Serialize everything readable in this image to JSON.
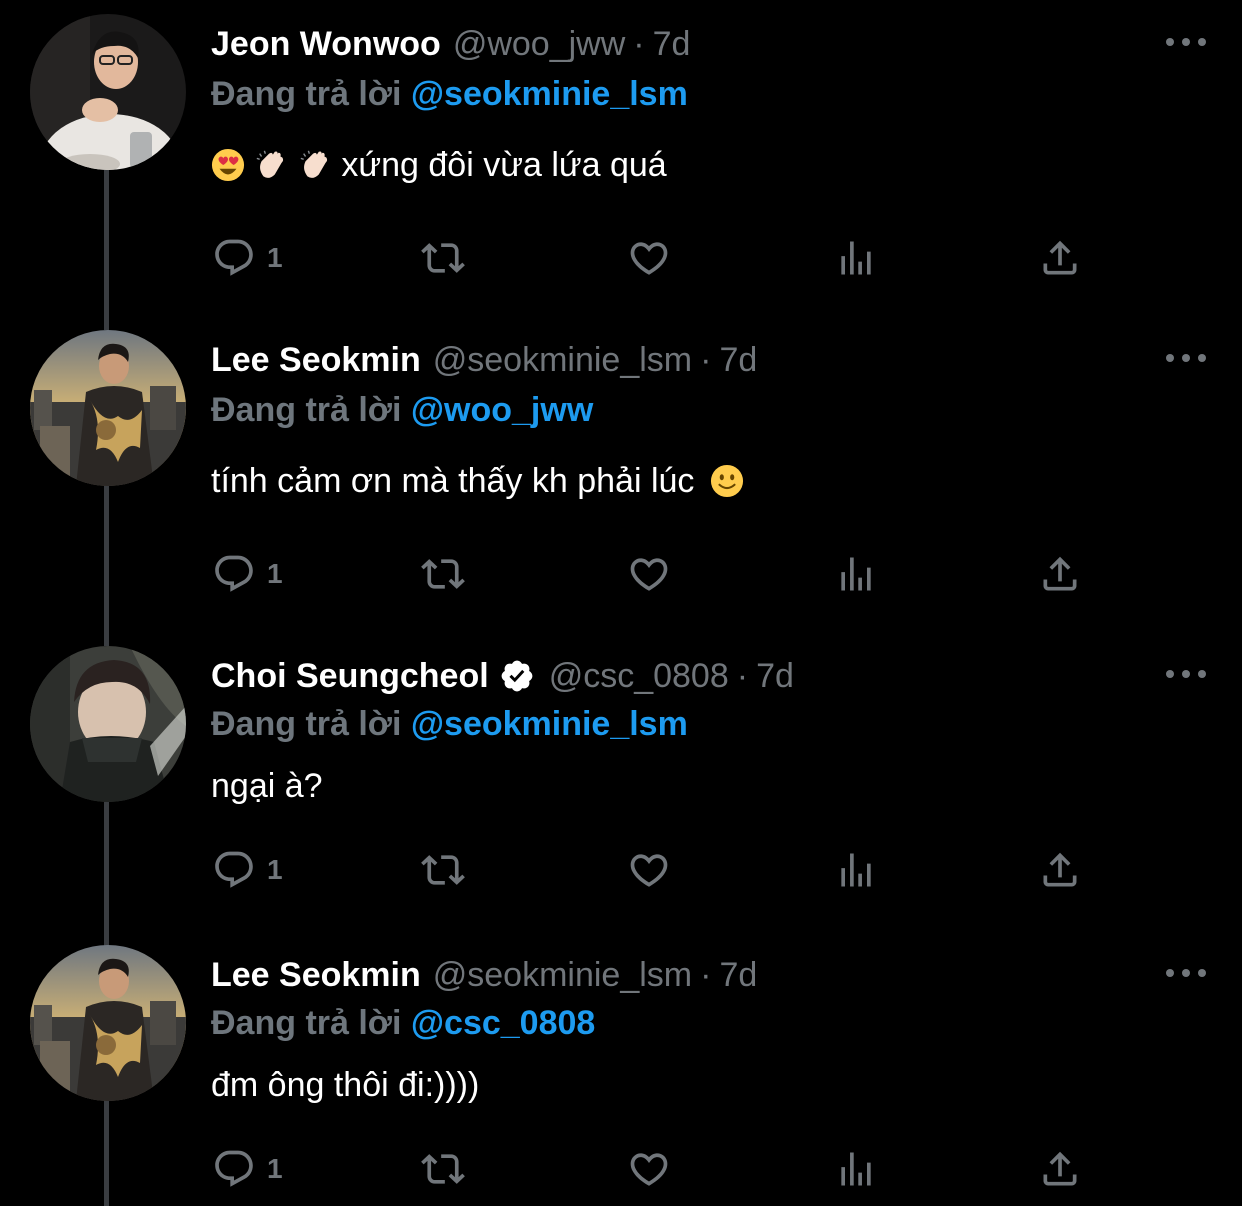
{
  "colors": {
    "background": "#000000",
    "name": "#ffffff",
    "secondary": "#71767b",
    "link": "#1d9bf0",
    "thread_line": "#3a3d41"
  },
  "tweets": [
    {
      "name": "Jeon Wonwoo",
      "verified": false,
      "handle": "@woo_jww",
      "separator": "·",
      "time": "7d",
      "replying_label": "Đang trả lời",
      "replying_to": "@seokminie_lsm",
      "text": "xứng đôi vừa lứa quá",
      "emojis_before": [
        "heart-eyes",
        "clap",
        "clap"
      ],
      "emojis_after": [],
      "reply_count": "1"
    },
    {
      "name": "Lee Seokmin",
      "verified": false,
      "handle": "@seokminie_lsm",
      "separator": "·",
      "time": "7d",
      "replying_label": "Đang trả lời",
      "replying_to": "@woo_jww",
      "text": "tính cảm ơn mà thấy kh phải lúc",
      "emojis_before": [],
      "emojis_after": [
        "slight-smile"
      ],
      "reply_count": "1"
    },
    {
      "name": "Choi Seungcheol",
      "verified": true,
      "handle": "@csc_0808",
      "separator": "·",
      "time": "7d",
      "replying_label": "Đang trả lời",
      "replying_to": "@seokminie_lsm",
      "text": "ngại à?",
      "emojis_before": [],
      "emojis_after": [],
      "reply_count": "1"
    },
    {
      "name": "Lee Seokmin",
      "verified": false,
      "handle": "@seokminie_lsm",
      "separator": "·",
      "time": "7d",
      "replying_label": "Đang trả lời",
      "replying_to": "@csc_0808",
      "text": "đm ông thôi đi:))))",
      "emojis_before": [],
      "emojis_after": [],
      "reply_count": "1"
    }
  ],
  "icons": {
    "reply": "reply-bubble-icon",
    "retweet": "retweet-icon",
    "like": "heart-icon",
    "views": "analytics-icon",
    "share": "share-icon",
    "more": "more-options-icon",
    "verified": "verified-badge-icon"
  }
}
